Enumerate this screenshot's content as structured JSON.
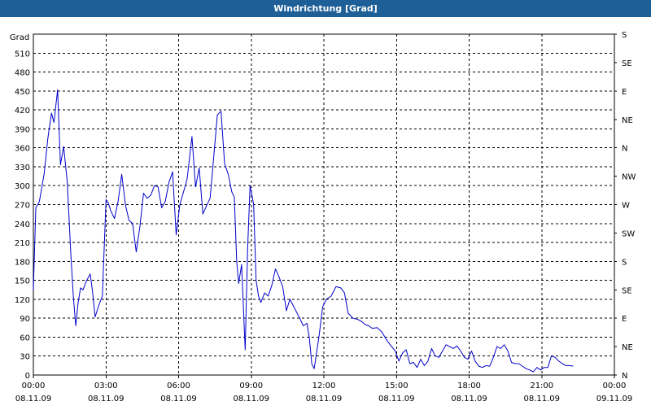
{
  "window": {
    "title": "Windrichtung [Grad]"
  },
  "chart_data": {
    "type": "line",
    "title": "Windrichtung [Grad]",
    "ylabel": "Grad",
    "ylim": [
      0,
      540
    ],
    "y_ticks": [
      0,
      30,
      60,
      90,
      120,
      150,
      180,
      210,
      240,
      270,
      300,
      330,
      360,
      390,
      420,
      450,
      480,
      510
    ],
    "y_right_ticks": [
      "N",
      "NE",
      "E",
      "SE",
      "S",
      "SW",
      "W",
      "NW",
      "N",
      "NE",
      "E",
      "SE",
      "S"
    ],
    "x_tick_labels": [
      {
        "time": "00:00",
        "date": "08.11.09"
      },
      {
        "time": "03:00",
        "date": "08.11.09"
      },
      {
        "time": "06:00",
        "date": "08.11.09"
      },
      {
        "time": "09:00",
        "date": "08.11.09"
      },
      {
        "time": "12:00",
        "date": "08.11.09"
      },
      {
        "time": "15:00",
        "date": "08.11.09"
      },
      {
        "time": "18:00",
        "date": "08.11.09"
      },
      {
        "time": "21:00",
        "date": "08.11.09"
      },
      {
        "time": "00:00",
        "date": "09.11.09"
      }
    ],
    "x_unit": "hours",
    "xlim": [
      0,
      24
    ],
    "grid": true,
    "series": [
      {
        "color": "#0000cc",
        "points": [
          [
            0.0,
            135
          ],
          [
            0.1,
            265
          ],
          [
            0.25,
            275
          ],
          [
            0.45,
            320
          ],
          [
            0.6,
            375
          ],
          [
            0.75,
            415
          ],
          [
            0.85,
            400
          ],
          [
            1.0,
            452
          ],
          [
            1.12,
            333
          ],
          [
            1.25,
            362
          ],
          [
            1.4,
            305
          ],
          [
            1.55,
            190
          ],
          [
            1.65,
            125
          ],
          [
            1.75,
            78
          ],
          [
            1.85,
            115
          ],
          [
            1.95,
            138
          ],
          [
            2.05,
            135
          ],
          [
            2.2,
            150
          ],
          [
            2.35,
            160
          ],
          [
            2.45,
            130
          ],
          [
            2.55,
            92
          ],
          [
            2.7,
            110
          ],
          [
            2.85,
            125
          ],
          [
            3.0,
            278
          ],
          [
            3.1,
            272
          ],
          [
            3.2,
            260
          ],
          [
            3.35,
            248
          ],
          [
            3.5,
            275
          ],
          [
            3.65,
            318
          ],
          [
            3.8,
            270
          ],
          [
            3.95,
            245
          ],
          [
            4.1,
            240
          ],
          [
            4.25,
            195
          ],
          [
            4.4,
            235
          ],
          [
            4.55,
            288
          ],
          [
            4.7,
            280
          ],
          [
            4.85,
            285
          ],
          [
            5.0,
            300
          ],
          [
            5.15,
            298
          ],
          [
            5.3,
            265
          ],
          [
            5.45,
            275
          ],
          [
            5.6,
            305
          ],
          [
            5.75,
            322
          ],
          [
            5.9,
            222
          ],
          [
            6.05,
            270
          ],
          [
            6.2,
            290
          ],
          [
            6.35,
            310
          ],
          [
            6.55,
            378
          ],
          [
            6.7,
            298
          ],
          [
            6.85,
            328
          ],
          [
            7.0,
            255
          ],
          [
            7.15,
            268
          ],
          [
            7.3,
            280
          ],
          [
            7.45,
            345
          ],
          [
            7.6,
            412
          ],
          [
            7.75,
            418
          ],
          [
            7.9,
            335
          ],
          [
            8.05,
            318
          ],
          [
            8.2,
            290
          ],
          [
            8.3,
            282
          ],
          [
            8.4,
            180
          ],
          [
            8.48,
            145
          ],
          [
            8.6,
            175
          ],
          [
            8.75,
            40
          ],
          [
            8.85,
            200
          ],
          [
            8.95,
            300
          ],
          [
            9.1,
            270
          ],
          [
            9.2,
            150
          ],
          [
            9.3,
            125
          ],
          [
            9.4,
            115
          ],
          [
            9.55,
            130
          ],
          [
            9.7,
            125
          ],
          [
            9.85,
            142
          ],
          [
            10.0,
            168
          ],
          [
            10.15,
            155
          ],
          [
            10.3,
            140
          ],
          [
            10.45,
            102
          ],
          [
            10.6,
            120
          ],
          [
            10.8,
            105
          ],
          [
            11.0,
            90
          ],
          [
            11.15,
            78
          ],
          [
            11.3,
            82
          ],
          [
            11.4,
            58
          ],
          [
            11.5,
            18
          ],
          [
            11.6,
            10
          ],
          [
            11.8,
            62
          ],
          [
            11.95,
            108
          ],
          [
            12.1,
            120
          ],
          [
            12.3,
            125
          ],
          [
            12.5,
            140
          ],
          [
            12.7,
            138
          ],
          [
            12.85,
            130
          ],
          [
            13.0,
            98
          ],
          [
            13.2,
            90
          ],
          [
            13.4,
            88
          ],
          [
            13.55,
            85
          ],
          [
            13.7,
            80
          ],
          [
            13.85,
            78
          ],
          [
            14.0,
            74
          ],
          [
            14.2,
            75
          ],
          [
            14.4,
            68
          ],
          [
            14.6,
            55
          ],
          [
            14.8,
            45
          ],
          [
            14.95,
            38
          ],
          [
            15.1,
            22
          ],
          [
            15.25,
            35
          ],
          [
            15.4,
            40
          ],
          [
            15.55,
            18
          ],
          [
            15.7,
            20
          ],
          [
            15.85,
            12
          ],
          [
            16.0,
            25
          ],
          [
            16.15,
            15
          ],
          [
            16.3,
            22
          ],
          [
            16.45,
            42
          ],
          [
            16.6,
            30
          ],
          [
            16.75,
            28
          ],
          [
            16.9,
            38
          ],
          [
            17.05,
            48
          ],
          [
            17.2,
            45
          ],
          [
            17.35,
            42
          ],
          [
            17.5,
            46
          ],
          [
            17.65,
            38
          ],
          [
            17.8,
            28
          ],
          [
            17.95,
            25
          ],
          [
            18.1,
            38
          ],
          [
            18.25,
            22
          ],
          [
            18.4,
            14
          ],
          [
            18.55,
            12
          ],
          [
            18.7,
            15
          ],
          [
            18.85,
            14
          ],
          [
            19.0,
            28
          ],
          [
            19.15,
            45
          ],
          [
            19.3,
            42
          ],
          [
            19.45,
            48
          ],
          [
            19.6,
            38
          ],
          [
            19.75,
            20
          ],
          [
            19.9,
            18
          ],
          [
            20.05,
            18
          ],
          [
            20.2,
            14
          ],
          [
            20.35,
            10
          ],
          [
            20.5,
            8
          ],
          [
            20.65,
            5
          ],
          [
            20.8,
            12
          ],
          [
            20.95,
            8
          ],
          [
            21.1,
            12
          ],
          [
            21.25,
            12
          ],
          [
            21.4,
            30
          ],
          [
            21.55,
            28
          ],
          [
            21.7,
            22
          ],
          [
            21.85,
            18
          ],
          [
            22.0,
            15
          ],
          [
            22.15,
            15
          ],
          [
            22.3,
            14
          ]
        ]
      }
    ]
  }
}
